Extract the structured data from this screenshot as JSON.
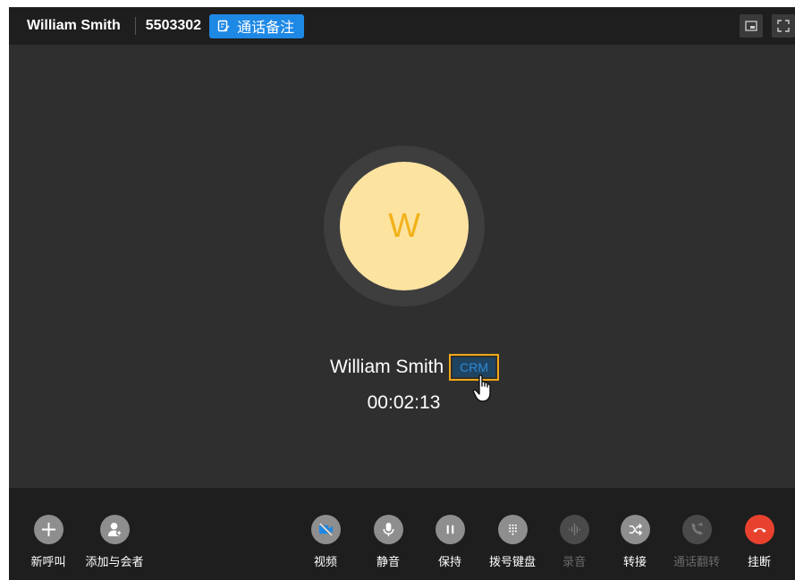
{
  "titlebar": {
    "caller_name": "William Smith",
    "number": "5503302",
    "notes_label": "通话备注"
  },
  "caller": {
    "avatar_initial": "W",
    "name": "William Smith",
    "crm_label": "CRM",
    "duration": "00:02:13"
  },
  "controls": {
    "new_call": "新呼叫",
    "add_participant": "添加与会者",
    "video": "视频",
    "mute": "静音",
    "hold": "保持",
    "dialpad": "拨号键盘",
    "record": "录音",
    "transfer": "转接",
    "call_flip": "通话翻转",
    "hangup": "挂断"
  },
  "colors": {
    "accent": "#1e88e5",
    "avatar_bg": "#fde3a0",
    "avatar_text": "#f2b21b",
    "highlight": "#f0a818",
    "hangup": "#e8422f"
  }
}
